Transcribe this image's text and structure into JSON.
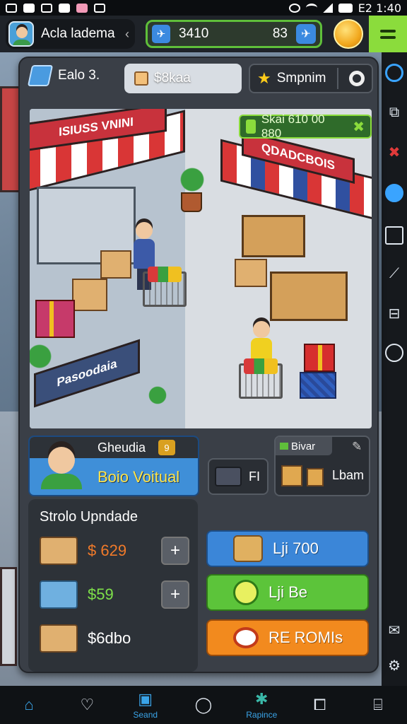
{
  "status": {
    "time": "E2 1:40"
  },
  "header": {
    "player_name": "Acla ladema",
    "currency_value": "3410",
    "currency_secondary": "83",
    "colors": {
      "accent": "#5fbf3a",
      "menu": "#8bdc3c",
      "coin": "#f2a81d"
    }
  },
  "panel": {
    "level_label": "Ealo 3.",
    "search_value": "$8kaa",
    "stars_label": "Smpnim",
    "bonus_label": "Skai 610 00 880",
    "scene_sign_left": "ISIUSS VNINI",
    "scene_sign_right": "QDADCBOIS",
    "scene_sign_front": "Pasoodaia"
  },
  "manager": {
    "name": "Gheudia",
    "badge": "9",
    "role": "Boio Voitual"
  },
  "truck": {
    "value": "FI"
  },
  "boxes": {
    "label": "Bivar",
    "value": "Lbam"
  },
  "upgrades": {
    "title": "Strolo Upndade",
    "items": [
      {
        "price": "$ 629",
        "color": "#f07a2a"
      },
      {
        "price": "$59",
        "color": "#7ee04a"
      },
      {
        "price": "$6dbo",
        "color": "#ffffff"
      }
    ]
  },
  "actions": [
    {
      "label": "Lji 700"
    },
    {
      "label": "Lji Be"
    },
    {
      "label": "RE ROMIs"
    }
  ],
  "nav": {
    "items": [
      {
        "label": ""
      },
      {
        "label": ""
      },
      {
        "label": "Seand"
      },
      {
        "label": ""
      },
      {
        "label": "Rapince"
      },
      {
        "label": ""
      },
      {
        "label": ""
      }
    ]
  }
}
